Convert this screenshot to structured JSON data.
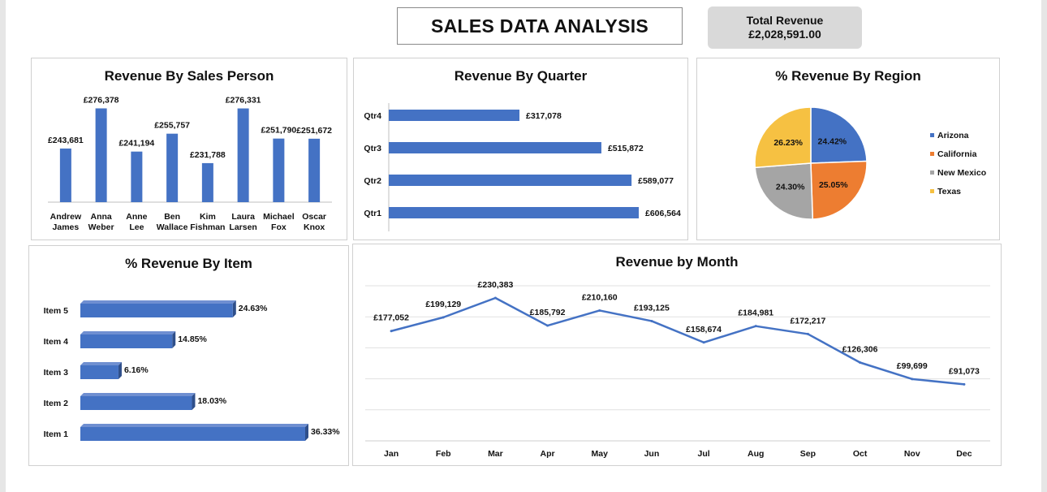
{
  "header": {
    "title": "SALES DATA ANALYSIS",
    "kpi_label": "Total Revenue",
    "kpi_value": "£2,028,591.00"
  },
  "colors": {
    "bar": "#4472c4",
    "bar_dark": "#2f4f8a",
    "arizona": "#4472c4",
    "california": "#ed7d31",
    "new_mexico": "#a5a5a5",
    "texas": "#f6c142"
  },
  "chart_data": [
    {
      "id": "sales_person",
      "type": "bar",
      "title": "Revenue By Sales Person",
      "categories": [
        "Andrew James",
        "Anna Weber",
        "Anne Lee",
        "Ben Wallace",
        "Kim Fishman",
        "Laura Larsen",
        "Michael Fox",
        "Oscar Knox"
      ],
      "category_lines": [
        [
          "Andrew",
          "James"
        ],
        [
          "Anna",
          "Weber"
        ],
        [
          "Anne",
          "Lee"
        ],
        [
          "Ben",
          "Wallace"
        ],
        [
          "Kim",
          "Fishman"
        ],
        [
          "Laura",
          "Larsen"
        ],
        [
          "Michael",
          "Fox"
        ],
        [
          "Oscar",
          "Knox"
        ]
      ],
      "values": [
        243681,
        276378,
        241194,
        255757,
        231788,
        276331,
        251790,
        251672
      ],
      "labels": [
        "£243,681",
        "£276,378",
        "£241,194",
        "£255,757",
        "£231,788",
        "£276,331",
        "£251,790",
        "£251,672"
      ],
      "ylim": [
        200000,
        280000
      ]
    },
    {
      "id": "quarter",
      "type": "bar",
      "orientation": "horizontal",
      "title": "Revenue By Quarter",
      "categories": [
        "Qtr4",
        "Qtr3",
        "Qtr2",
        "Qtr1"
      ],
      "values": [
        317078,
        515872,
        589077,
        606564
      ],
      "labels": [
        "£317,078",
        "£515,872",
        "£589,077",
        "£606,564"
      ],
      "xlim": [
        0,
        606564
      ]
    },
    {
      "id": "region",
      "type": "pie",
      "title": "% Revenue By Region",
      "categories": [
        "Arizona",
        "California",
        "New Mexico",
        "Texas"
      ],
      "values": [
        24.42,
        25.05,
        24.3,
        26.23
      ],
      "labels": [
        "24.42%",
        "25.05%",
        "24.30%",
        "26.23%"
      ],
      "legend": "right"
    },
    {
      "id": "item",
      "type": "bar",
      "orientation": "horizontal",
      "title": "% Revenue By Item",
      "categories": [
        "Item 5",
        "Item 4",
        "Item 3",
        "Item 2",
        "Item 1"
      ],
      "values": [
        24.63,
        14.85,
        6.16,
        18.03,
        36.33
      ],
      "labels": [
        "24.63%",
        "14.85%",
        "6.16%",
        "18.03%",
        "36.33%"
      ]
    },
    {
      "id": "month",
      "type": "line",
      "title": "Revenue by Month",
      "x": [
        "Jan",
        "Feb",
        "Mar",
        "Apr",
        "May",
        "Jun",
        "Jul",
        "Aug",
        "Sep",
        "Oct",
        "Nov",
        "Dec"
      ],
      "values": [
        177052,
        199129,
        230383,
        185792,
        210160,
        193125,
        158674,
        184981,
        172217,
        126306,
        99699,
        91073
      ],
      "labels": [
        "£177,052",
        "£199,129",
        "£230,383",
        "£185,792",
        "£210,160",
        "£193,125",
        "£158,674",
        "£184,981",
        "£172,217",
        "£126,306",
        "£99,699",
        "£91,073"
      ],
      "ylim": [
        0,
        250000
      ],
      "grid": true
    }
  ]
}
